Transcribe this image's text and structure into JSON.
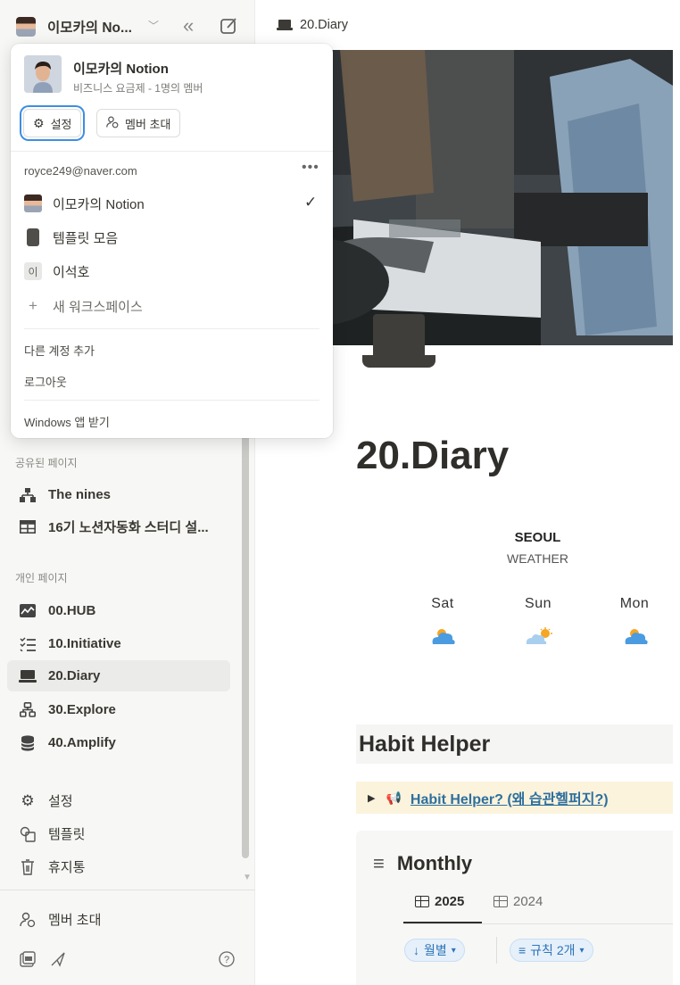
{
  "sidebar": {
    "workspace_name": "이모카의 No...",
    "sections": {
      "shared": "공유된 페이지",
      "private": "개인 페이지"
    },
    "shared_pages": [
      {
        "label": "The nines",
        "icon": "hierarchy-icon"
      },
      {
        "label": "16기 노션자동화 스터디 설...",
        "icon": "table-icon"
      }
    ],
    "private_pages": [
      {
        "label": "00.HUB",
        "icon": "chart-icon"
      },
      {
        "label": "10.Initiative",
        "icon": "checklist-icon"
      },
      {
        "label": "20.Diary",
        "icon": "laptop-icon"
      },
      {
        "label": "30.Explore",
        "icon": "sitemap-icon"
      },
      {
        "label": "40.Amplify",
        "icon": "database-icon"
      }
    ],
    "utility": [
      {
        "label": "설정",
        "icon": "gear-icon"
      },
      {
        "label": "템플릿",
        "icon": "template-icon"
      },
      {
        "label": "휴지통",
        "icon": "trash-icon"
      }
    ],
    "invite_label": "멤버 초대"
  },
  "breadcrumb": {
    "page": "20.Diary"
  },
  "page": {
    "title": "20.Diary",
    "weather": {
      "city": "SEOUL",
      "subtitle": "WEATHER",
      "days": [
        {
          "day": "Sat",
          "icon": "cloud-icon"
        },
        {
          "day": "Sun",
          "icon": "partly-sunny-icon"
        },
        {
          "day": "Mon",
          "icon": "cloud-icon"
        }
      ]
    },
    "habit_heading": "Habit Helper",
    "callout_link": "Habit Helper? (왜 습관헬퍼지?)",
    "database": {
      "title": "Monthly",
      "tabs": [
        "2025",
        "2024"
      ],
      "active_tab": "2025",
      "filters": [
        {
          "label": "월별",
          "icon": "arrow-down-icon"
        },
        {
          "label": "규칙 2개",
          "icon": "filter-icon"
        }
      ]
    }
  },
  "popup": {
    "workspace_name": "이모카의 Notion",
    "plan": "비즈니스 요금제 - 1명의 멤버",
    "settings_label": "설정",
    "invite_label": "멤버 초대",
    "account_email": "royce249@naver.com",
    "workspaces": [
      {
        "label": "이모카의 Notion",
        "icon": "avatar",
        "checked": true
      },
      {
        "label": "템플릿 모음",
        "icon": "notebook-icon",
        "checked": false
      },
      {
        "label": "이석호",
        "icon_text": "이",
        "checked": false
      }
    ],
    "new_workspace_label": "새 워크스페이스",
    "add_account_label": "다른 계정 추가",
    "logout_label": "로그아웃",
    "windows_app_label": "Windows 앱 받기"
  },
  "colors": {
    "sidebar_bg": "#f7f7f5",
    "link_blue": "#2e6f9e",
    "callout_bg": "#fbf3dc",
    "focus_ring": "#3d8ee3"
  }
}
